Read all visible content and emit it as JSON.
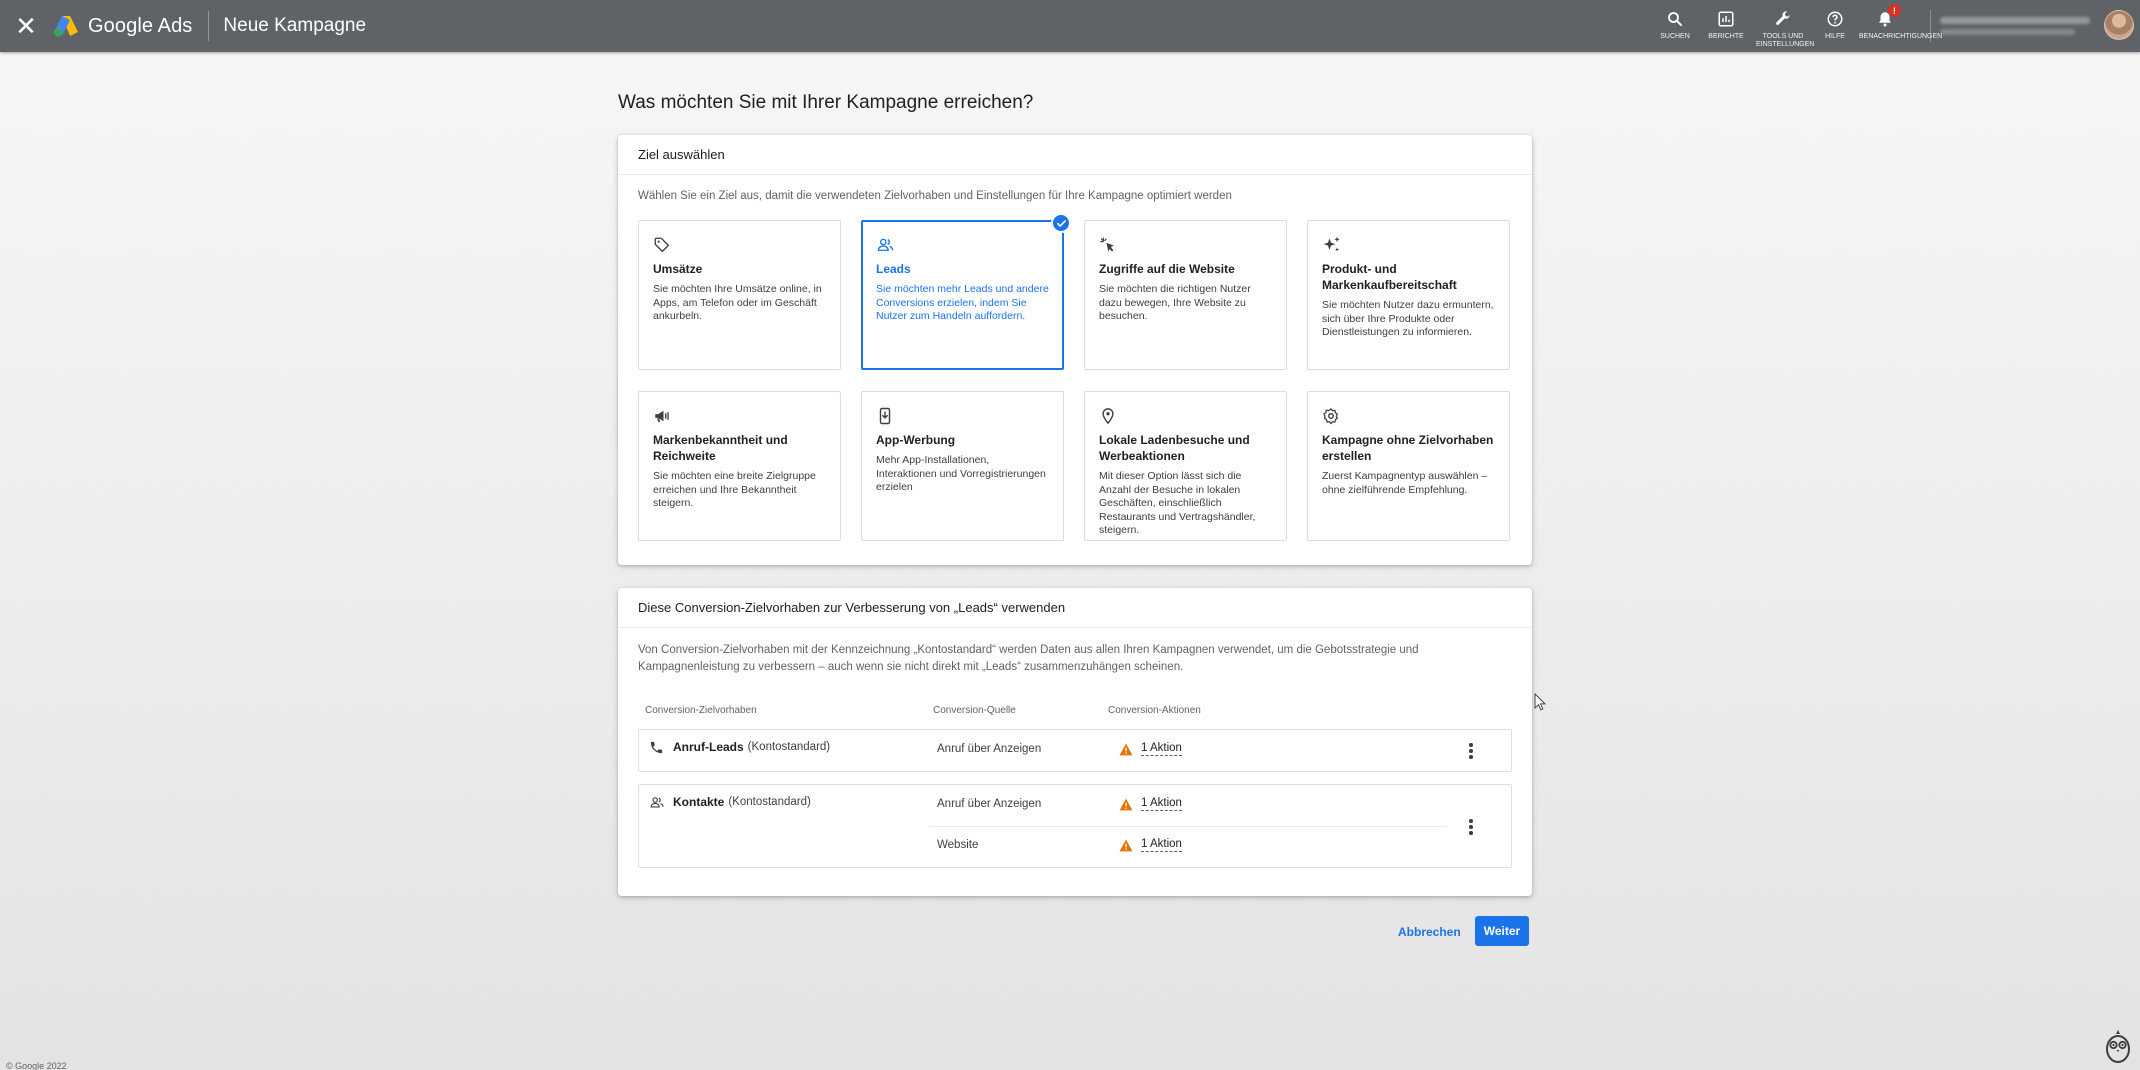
{
  "topbar": {
    "app_name": "Google Ads",
    "page_name": "Neue Kampagne",
    "actions": [
      {
        "label": "SUCHEN",
        "icon": "search-icon"
      },
      {
        "label": "BERICHTE",
        "icon": "reports-icon"
      },
      {
        "label": "TOOLS UND EINSTELLUNGEN",
        "icon": "wrench-icon"
      },
      {
        "label": "HILFE",
        "icon": "help-icon"
      },
      {
        "label": "BENACHRICHTIGUNGEN",
        "icon": "bell-icon",
        "badge": "!"
      }
    ]
  },
  "heading": "Was möchten Sie mit Ihrer Kampagne erreichen?",
  "goal_card": {
    "title": "Ziel auswählen",
    "description": "Wählen Sie ein Ziel aus, damit die verwendeten Zielvorhaben und Einstellungen für Ihre Kampagne optimiert werden",
    "tiles": [
      {
        "icon": "tag-icon",
        "title": "Umsätze",
        "desc": "Sie möchten Ihre Umsätze online, in Apps, am Telefon oder im Geschäft ankurbeln.",
        "selected": false
      },
      {
        "icon": "people-icon",
        "title": "Leads",
        "desc": "Sie möchten mehr Leads und andere Conversions erzielen, indem Sie Nutzer zum Handeln auffordern.",
        "selected": true
      },
      {
        "icon": "cursor-click-icon",
        "title": "Zugriffe auf die Website",
        "desc": "Sie möchten die richtigen Nutzer dazu bewegen, Ihre Website zu besuchen.",
        "selected": false
      },
      {
        "icon": "sparkle-icon",
        "title": "Produkt- und Markenkaufbereitschaft",
        "desc": "Sie möchten Nutzer dazu ermuntern, sich über Ihre Produkte oder Dienstleistungen zu informieren.",
        "selected": false
      },
      {
        "icon": "megaphone-icon",
        "title": "Markenbekanntheit und Reichweite",
        "desc": "Sie möchten eine breite Zielgruppe erreichen und Ihre Bekanntheit steigern.",
        "selected": false
      },
      {
        "icon": "phone-app-icon",
        "title": "App-Werbung",
        "desc": "Mehr App-Installationen, Interaktionen und Vorregistrierungen erzielen",
        "selected": false
      },
      {
        "icon": "location-pin-icon",
        "title": "Lokale Ladenbesuche und Werbeaktionen",
        "desc": "Mit dieser Option lässt sich die Anzahl der Besuche in lokalen Geschäften, einschließlich Restaurants und Vertragshändler, steigern.",
        "selected": false
      },
      {
        "icon": "gear-icon",
        "title": "Kampagne ohne Zielvorhaben erstellen",
        "desc": "Zuerst Kampagnentyp auswählen – ohne zielführende Empfehlung.",
        "selected": false
      }
    ]
  },
  "conversion_card": {
    "title": "Diese Conversion-Zielvorhaben zur Verbesserung von „Leads“ verwenden",
    "description": "Von Conversion-Zielvorhaben mit der Kennzeichnung „Kontostandard“ werden Daten aus allen Ihren Kampagnen verwendet, um die Gebotsstrategie und Kampagnenleistung zu verbessern – auch wenn sie nicht direkt mit „Leads“ zusammenzuhängen scheinen.",
    "columns": [
      "Conversion-Zielvorhaben",
      "Conversion-Quelle",
      "Conversion-Aktionen"
    ],
    "rows": [
      {
        "icon": "phone-icon",
        "name": "Anruf-Leads",
        "tag": "(Kontostandard)",
        "entries": [
          {
            "source": "Anruf über Anzeigen",
            "actions": "1 Aktion"
          }
        ]
      },
      {
        "icon": "contacts-icon",
        "name": "Kontakte",
        "tag": "(Kontostandard)",
        "entries": [
          {
            "source": "Anruf über Anzeigen",
            "actions": "1 Aktion"
          },
          {
            "source": "Website",
            "actions": "1 Aktion"
          }
        ]
      }
    ]
  },
  "footer": {
    "cancel_label": "Abbrechen",
    "next_label": "Weiter",
    "copyright": "© Google 2022"
  },
  "colors": {
    "topbar": "#5f6368",
    "accent": "#1a73e8",
    "warning": "#e37400"
  }
}
